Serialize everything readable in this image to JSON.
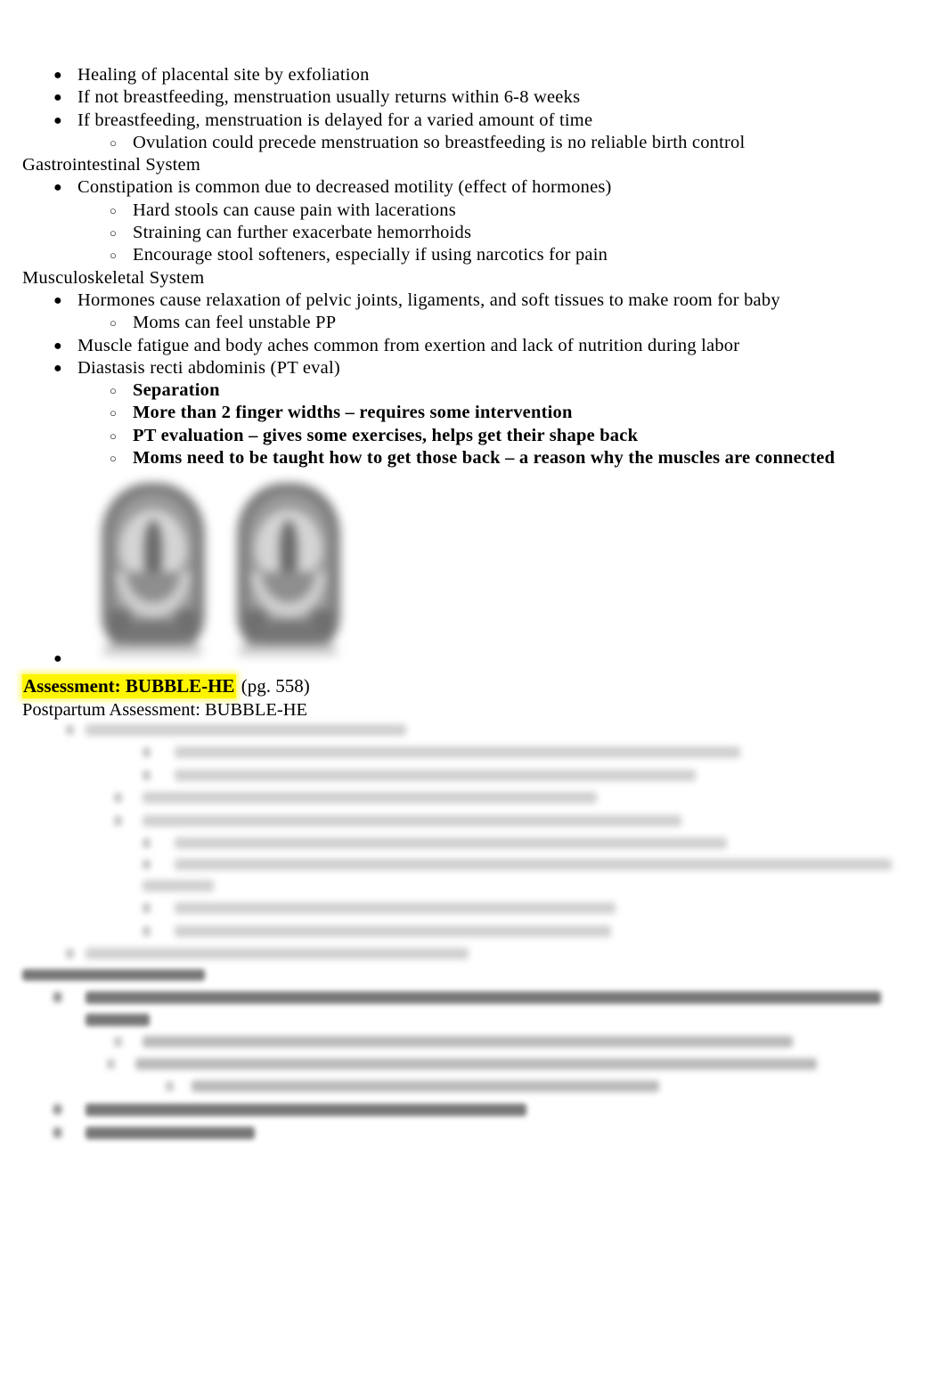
{
  "document": {
    "page_background": "#ffffff",
    "text_color": "#000000",
    "highlight_color": "#fdf400"
  },
  "content": {
    "lines": [
      {
        "level": 1,
        "bullet": "filled-bullet",
        "text": "Healing of placental site by exfoliation",
        "bold": false
      },
      {
        "level": 1,
        "bullet": "filled-bullet",
        "text": "If not breastfeeding, menstruation usually returns within 6-8 weeks",
        "bold": false
      },
      {
        "level": 1,
        "bullet": "filled-bullet",
        "text": "If breastfeeding, menstruation is delayed for a varied amount of time",
        "bold": false
      },
      {
        "level": 2,
        "bullet": "hollow-bullet",
        "text": "Ovulation could precede menstruation so breastfeeding is no reliable birth control",
        "bold": false
      },
      {
        "level": 0,
        "bullet": "",
        "text": "Gastrointestinal System",
        "bold": false
      },
      {
        "level": 1,
        "bullet": "filled-bullet",
        "text": "Constipation is common due to decreased motility (effect of hormones)",
        "bold": false
      },
      {
        "level": 2,
        "bullet": "hollow-bullet",
        "text": "Hard stools can cause pain with lacerations",
        "bold": false
      },
      {
        "level": 2,
        "bullet": "hollow-bullet",
        "text": "Straining can further exacerbate hemorrhoids",
        "bold": false
      },
      {
        "level": 2,
        "bullet": "hollow-bullet",
        "text": "Encourage stool softeners, especially if using narcotics for pain",
        "bold": false
      },
      {
        "level": 0,
        "bullet": "",
        "text": "Musculoskeletal System",
        "bold": false
      },
      {
        "level": 1,
        "bullet": "filled-bullet",
        "text": "Hormones cause relaxation of pelvic joints, ligaments, and soft tissues to make room for baby",
        "bold": false
      },
      {
        "level": 2,
        "bullet": "hollow-bullet",
        "text": "Moms can feel unstable PP",
        "bold": false
      },
      {
        "level": 1,
        "bullet": "filled-bullet",
        "text": "Muscle fatigue and body aches common from exertion and lack of nutrition during labor",
        "bold": false
      },
      {
        "level": 1,
        "bullet": "filled-bullet",
        "text": "Diastasis recti abdominis (PT eval)",
        "bold": false
      },
      {
        "level": 2,
        "bullet": "hollow-bullet",
        "text": "Separation",
        "bold": true
      },
      {
        "level": 2,
        "bullet": "hollow-bullet",
        "text": "More than 2 finger widths – requires some intervention",
        "bold": true
      },
      {
        "level": 2,
        "bullet": "hollow-bullet",
        "text": "PT evaluation – gives some exercises, helps get their shape back",
        "bold": true
      },
      {
        "level": 2,
        "bullet": "hollow-bullet",
        "text": "Moms need to be taught how to get those back – a reason why the muscles are connected",
        "bold": true
      }
    ],
    "image_anchor_bullet": "filled-bullet",
    "figure": {
      "name": "diastasis-recti-abdomen-illustration",
      "description": "blurred grayscale illustration of two abdomens showing rectus muscle separation"
    },
    "assessment_heading": {
      "highlighted_text": "Assessment: BUBBLE-HE",
      "trailing_text": " (pg. 558)"
    },
    "assessment_subheading": "Postpartum Assessment: BUBBLE-HE",
    "obscured_note": "remaining BUBBLE-HE assessment notes are blurred and illegible in this screenshot"
  }
}
